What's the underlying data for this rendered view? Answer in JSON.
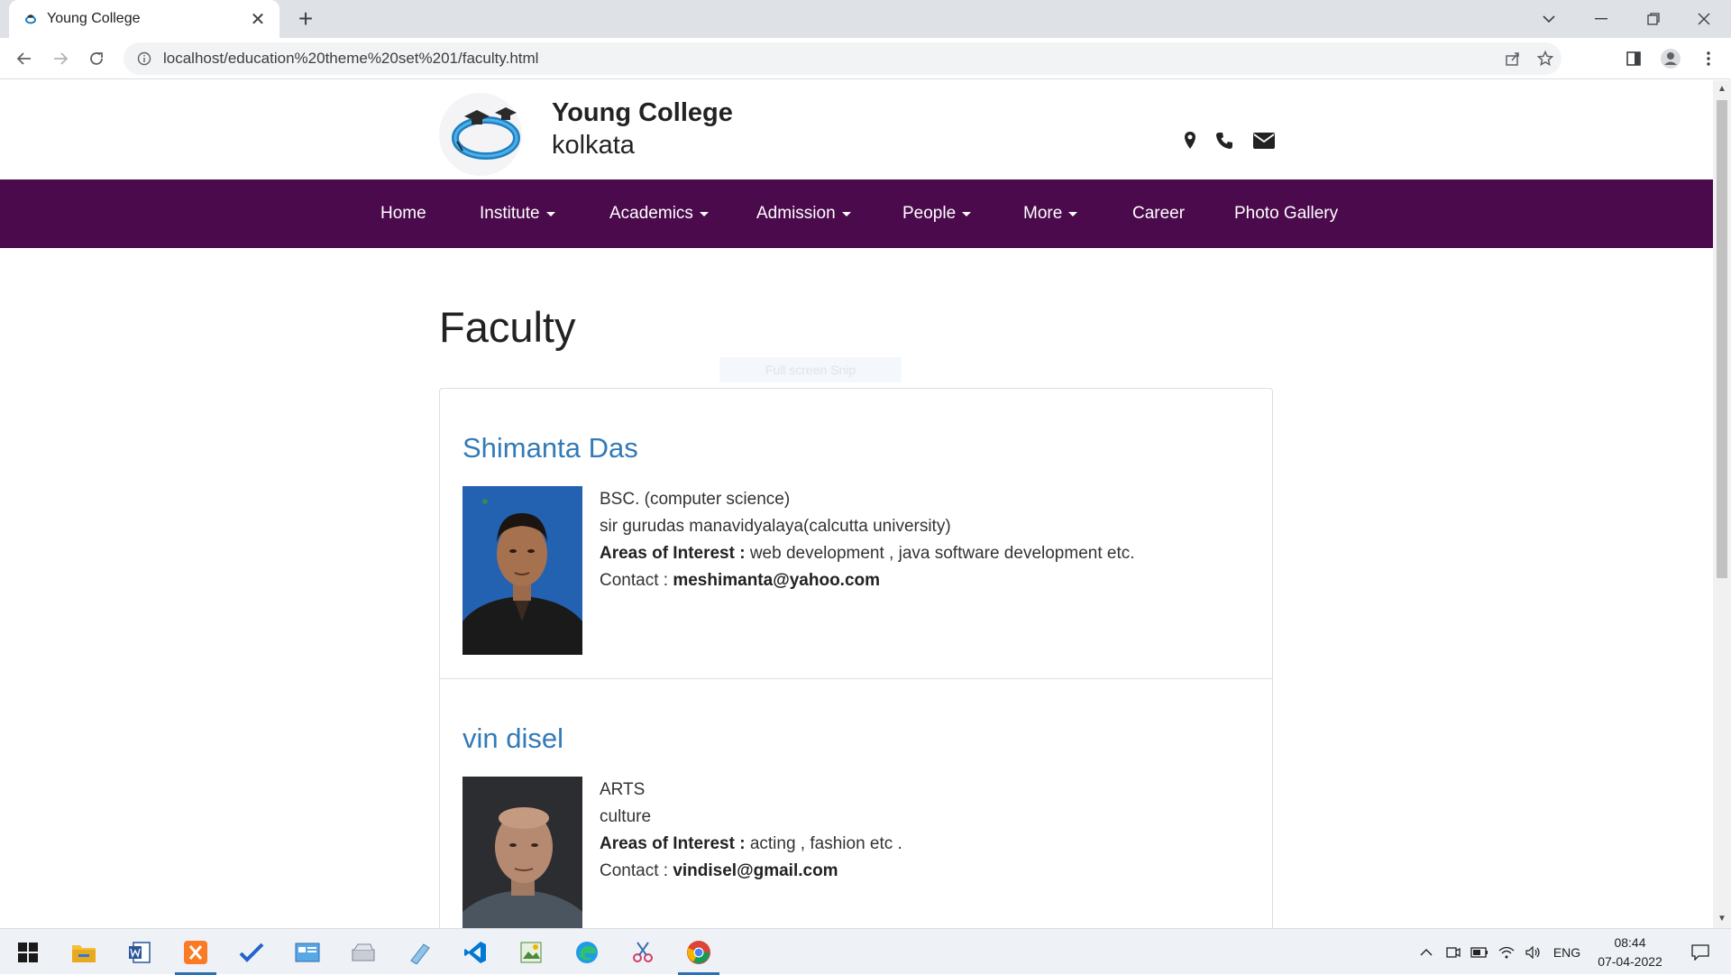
{
  "browser": {
    "tab_title": "Young College",
    "url": "localhost/education%20theme%20set%201/faculty.html",
    "new_tab_label": "+",
    "tab_close_label": "✕"
  },
  "site": {
    "brand_name": "Young College",
    "brand_city": "kolkata",
    "header_icons": [
      "map-marker-icon",
      "phone-icon",
      "envelope-icon"
    ],
    "accent_color": "#4a0a4c",
    "nav": [
      {
        "label": "Home",
        "dropdown": false
      },
      {
        "label": "Institute",
        "dropdown": true
      },
      {
        "label": "Academics",
        "dropdown": true
      },
      {
        "label": "Admission",
        "dropdown": true
      },
      {
        "label": "People",
        "dropdown": true
      },
      {
        "label": "More",
        "dropdown": true
      },
      {
        "label": "Career",
        "dropdown": false
      },
      {
        "label": "Photo Gallery",
        "dropdown": false
      }
    ]
  },
  "page": {
    "title": "Faculty",
    "hint_text": "Full screen Snip"
  },
  "faculty": [
    {
      "name": "Shimanta Das",
      "degree": "BSC. (computer science)",
      "institution": "sir gurudas manavidyalaya(calcutta university)",
      "interest_label": "Areas of Interest :",
      "interest": " web development , java software development etc.",
      "contact_label": "Contact : ",
      "contact": "meshimanta@yahoo.com"
    },
    {
      "name": "vin disel",
      "degree": "ARTS",
      "institution": "culture",
      "interest_label": "Areas of Interest :",
      "interest": " acting , fashion etc .",
      "contact_label": "Contact : ",
      "contact": "vindisel@gmail.com"
    }
  ],
  "taskbar": {
    "apps": [
      "windows-start-icon",
      "file-explorer-icon",
      "word-icon",
      "xampp-icon",
      "todo-icon",
      "control-panel-icon",
      "scanner-icon",
      "notepad-icon",
      "vscode-icon",
      "image-editor-icon",
      "edge-icon",
      "snipping-tool-icon",
      "chrome-icon"
    ],
    "language": "ENG",
    "time": "08:44",
    "date": "07-04-2022"
  }
}
